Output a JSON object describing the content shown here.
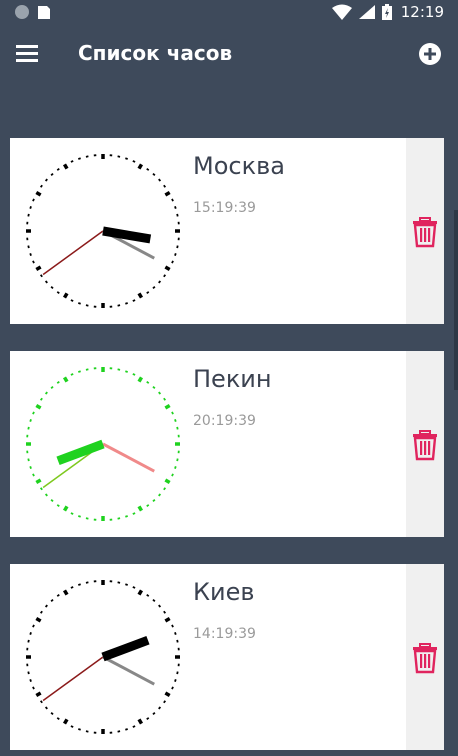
{
  "status_bar": {
    "time": "12:19"
  },
  "app_bar": {
    "title": "Список часов"
  },
  "clocks": [
    {
      "city": "Москва",
      "time": "15:19:39",
      "color": "#000000",
      "second_color": "#8b1a1a",
      "minute_color": "#888888"
    },
    {
      "city": "Пекин",
      "time": "20:19:39",
      "color": "#1fd21f",
      "second_color": "#7ec91e",
      "minute_color": "#f08a8a"
    },
    {
      "city": "Киев",
      "time": "14:19:39",
      "color": "#000000",
      "second_color": "#8b1a1a",
      "minute_color": "#888888"
    }
  ],
  "colors": {
    "background": "#3e4a5b",
    "delete": "#e0245e"
  },
  "icons": {
    "menu": "menu-icon",
    "add": "add-circle-icon",
    "delete": "trash-icon"
  }
}
